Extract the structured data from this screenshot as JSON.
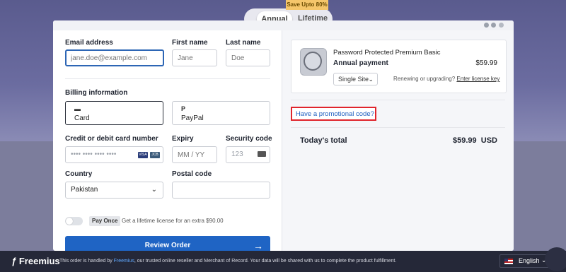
{
  "background": {
    "billing_toggle": {
      "annual_label": "Annual",
      "lifetime_label": "Lifetime",
      "save_badge": "Save Upto 80%"
    }
  },
  "form": {
    "email": {
      "label": "Email address",
      "placeholder": "jane.doe@example.com"
    },
    "first_name": {
      "label": "First name",
      "placeholder": "Jane"
    },
    "last_name": {
      "label": "Last name",
      "placeholder": "Doe"
    },
    "billing_label": "Billing information",
    "payment_methods": [
      {
        "label": "Card",
        "icon": "credit-card-icon"
      },
      {
        "label": "PayPal",
        "icon": "paypal-icon"
      }
    ],
    "card_number": {
      "label": "Credit or debit card number",
      "placeholder": "•••• •••• •••• ••••",
      "brands": [
        "VISA",
        "JCB"
      ]
    },
    "expiry": {
      "label": "Expiry",
      "placeholder": "MM / YY"
    },
    "security": {
      "label": "Security code",
      "placeholder": "123"
    },
    "country": {
      "label": "Country",
      "value": "Pakistan"
    },
    "postal": {
      "label": "Postal code",
      "value": ""
    },
    "pay_once": {
      "badge": "Pay Once",
      "text": "Get a lifetime license for an extra $90.00"
    },
    "review_button": "Review Order"
  },
  "summary": {
    "product_name": "Password Protected Premium Basic",
    "plan": "Annual payment",
    "price": "$59.99",
    "license_select": "Single Site",
    "renew_text": "Renewing or upgrading?",
    "license_link": "Enter license key",
    "promo_link": "Have a promotional code?",
    "total_label": "Today's total",
    "total_value": "$59.99",
    "currency": "USD"
  },
  "footer": {
    "brand": "Freemius",
    "message_prefix": "This order is handled by ",
    "message_brand": "Freemius",
    "message_suffix": ", our trusted online reseller and Merchant of Record. Your data will be shared with us to complete the product fulfillment.",
    "language": "English"
  },
  "colors": {
    "accent": "#1f64c4",
    "highlight": "#e0242c",
    "footer_bg": "#252838"
  }
}
